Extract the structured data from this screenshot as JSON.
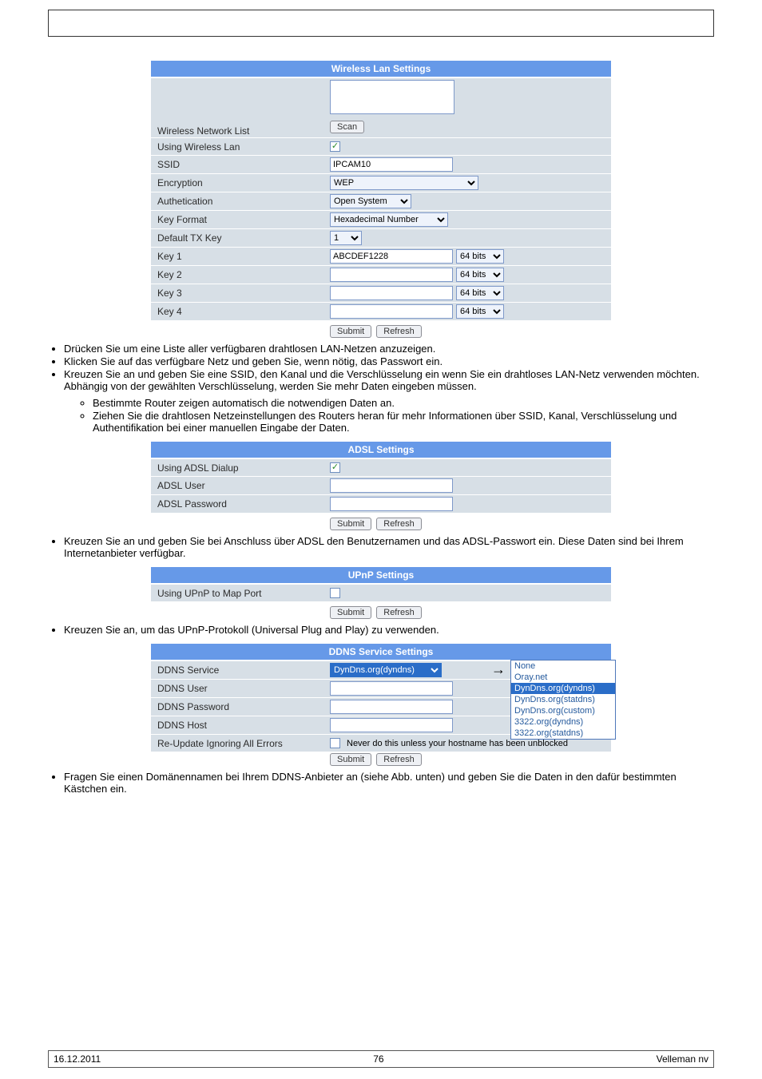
{
  "wireless": {
    "title": "Wireless Lan Settings",
    "network_list_label": "Wireless Network List",
    "scan_label": "Scan",
    "using_label": "Using Wireless Lan",
    "using_checked": true,
    "ssid_label": "SSID",
    "ssid_value": "IPCAM10",
    "encryption_label": "Encryption",
    "encryption_value": "WEP",
    "auth_label": "Authetication",
    "auth_value": "Open System",
    "keyformat_label": "Key Format",
    "keyformat_value": "Hexadecimal Number",
    "txkey_label": "Default TX Key",
    "txkey_value": "1",
    "key1_label": "Key 1",
    "key1_value": "ABCDEF1228",
    "key2_label": "Key 2",
    "key3_label": "Key 3",
    "key4_label": "Key 4",
    "bits_value": "64 bits",
    "submit": "Submit",
    "refresh": "Refresh"
  },
  "de_bullets1": {
    "b1a": "Drücken Sie ",
    "b1b": " um eine Liste aller verfügbaren drahtlosen LAN-Netzen anzuzeigen.",
    "b2": "Klicken Sie auf das verfügbare Netz und geben Sie, wenn nötig, das Passwort ein.",
    "b3a": "Kreuzen Sie ",
    "b3b": " an und geben Sie eine SSID, den Kanal und die Verschlüsselung ein wenn Sie ein drahtloses LAN-Netz verwenden möchten. Abhängig von der gewählten Verschlüsselung, werden Sie mehr Daten eingeben müssen.",
    "sub1": "Bestimmte Router zeigen automatisch die notwendigen Daten an.",
    "sub2": "Ziehen Sie die drahtlosen Netzeinstellungen des Routers heran für mehr Informationen über SSID, Kanal, Verschlüsselung und Authentifikation bei einer manuellen Eingabe der Daten."
  },
  "adsl": {
    "title": "ADSL Settings",
    "using_label": "Using ADSL Dialup",
    "using_checked": true,
    "user_label": "ADSL User",
    "pass_label": "ADSL Password",
    "submit": "Submit",
    "refresh": "Refresh"
  },
  "de_bullets2": {
    "b1": "Kreuzen Sie an und geben Sie bei Anschluss über ADSL den Benutzernamen und das ADSL-Passwort ein. Diese Daten sind bei Ihrem Internetanbieter verfügbar."
  },
  "upnp": {
    "title": "UPnP Settings",
    "using_label": "Using UPnP to Map Port",
    "using_checked": false,
    "submit": "Submit",
    "refresh": "Refresh"
  },
  "de_bullets3": {
    "b1": "Kreuzen Sie an, um das UPnP-Protokoll (Universal Plug and Play) zu verwenden."
  },
  "ddns": {
    "title": "DDNS Service Settings",
    "service_label": "DDNS Service",
    "service_value": "DynDns.org(dyndns)",
    "user_label": "DDNS User",
    "pass_label": "DDNS Password",
    "host_label": "DDNS Host",
    "reupdate_label": "Re-Update Ignoring All Errors",
    "reupdate_note": "Never do this unless your hostname has been unblocked",
    "submit": "Submit",
    "refresh": "Refresh",
    "options": [
      "None",
      "Oray.net",
      "DynDns.org(dyndns)",
      "DynDns.org(statdns)",
      "DynDns.org(custom)",
      "3322.org(dyndns)",
      "3322.org(statdns)"
    ]
  },
  "de_bullets4": {
    "b1": "Fragen Sie einen Domänennamen bei Ihrem DDNS-Anbieter an (siehe Abb. unten) und geben Sie die Daten in den dafür bestimmten Kästchen ein."
  },
  "footer": {
    "date": "16.12.2011",
    "page": "76",
    "company": "Velleman nv"
  }
}
